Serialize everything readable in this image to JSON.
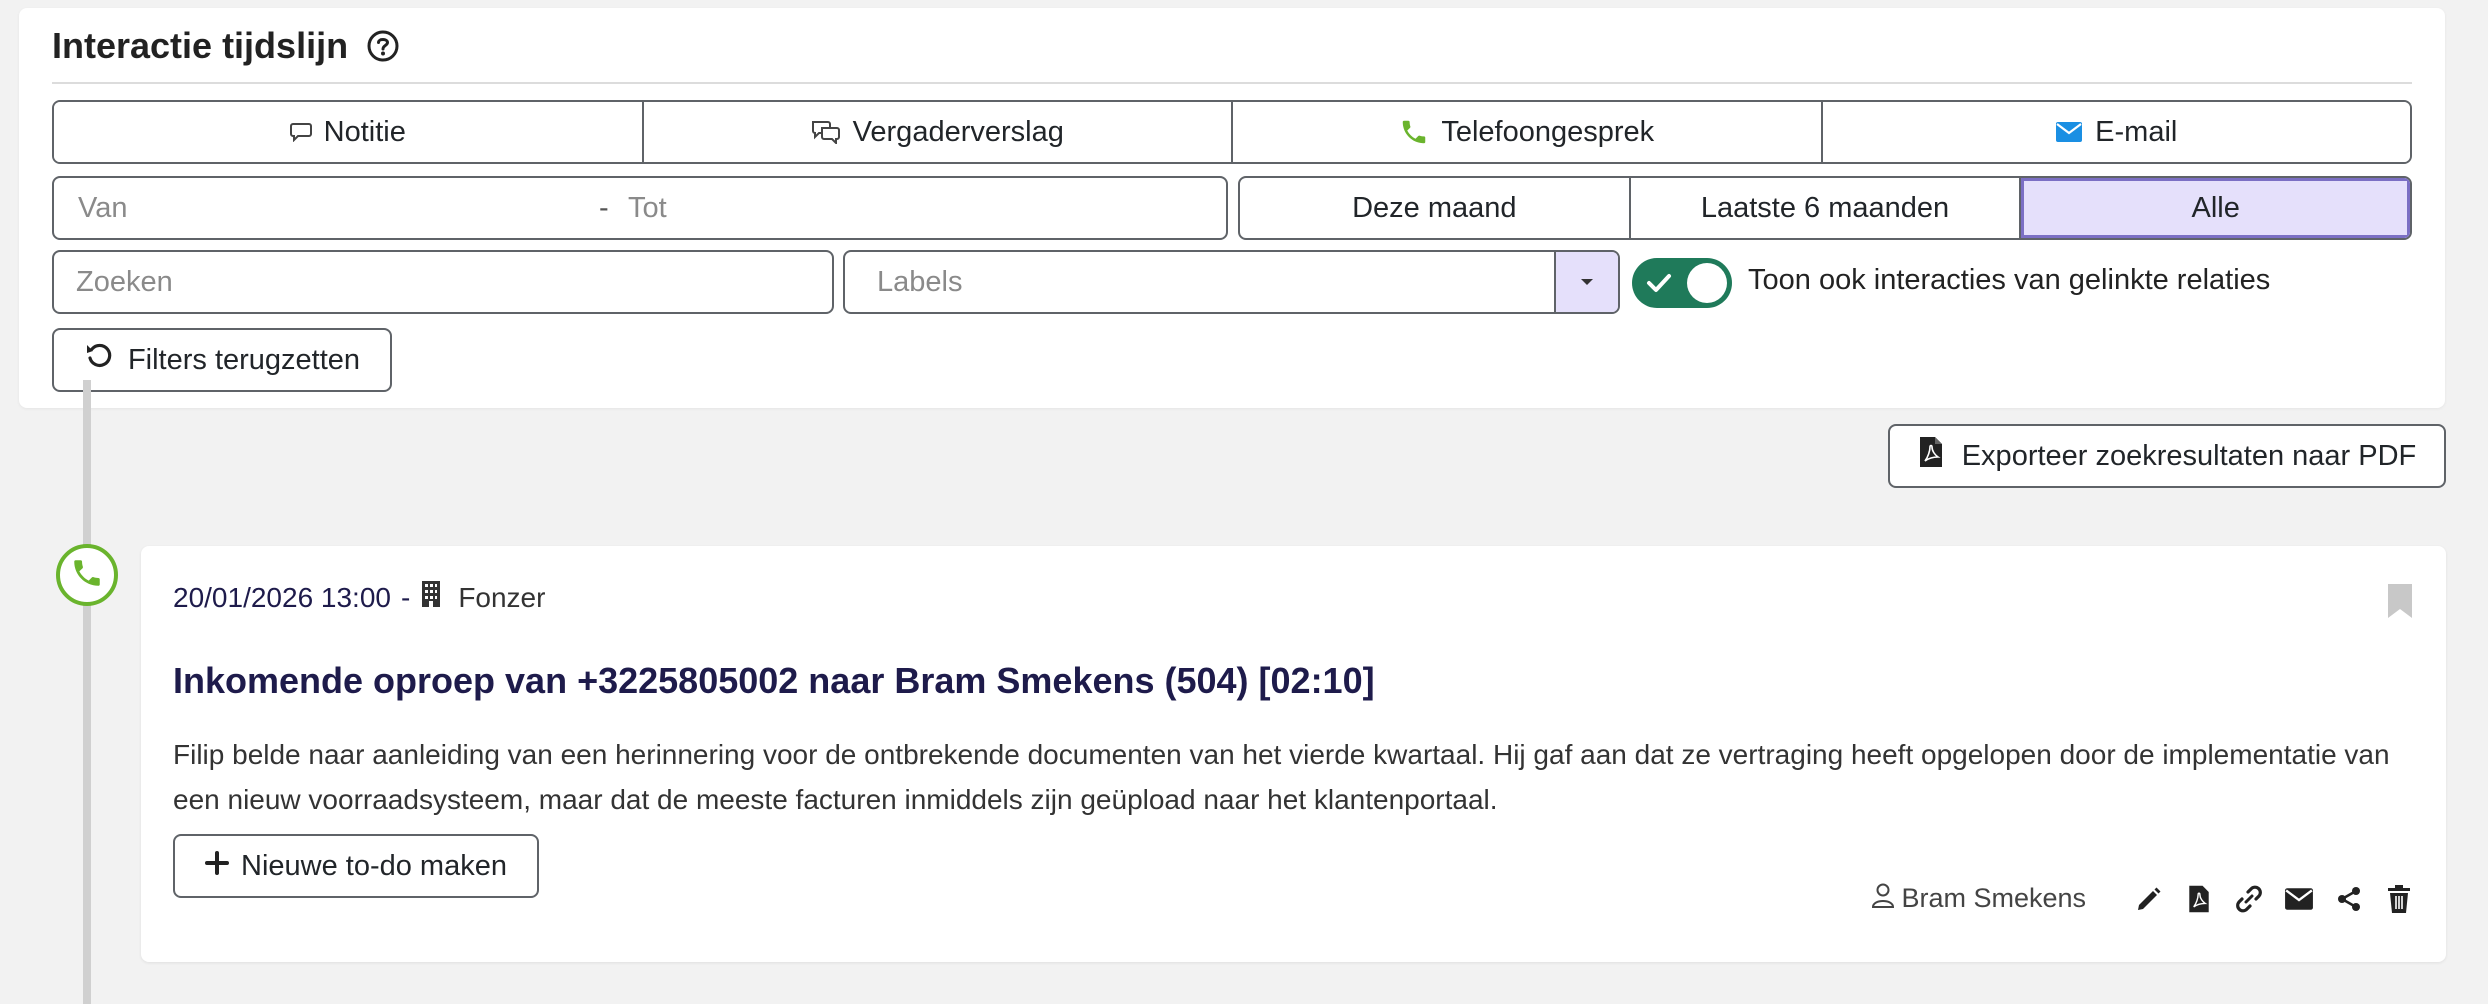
{
  "header": {
    "title": "Interactie tijdslijn"
  },
  "type_filters": [
    {
      "label": "Notitie",
      "icon": "note-icon"
    },
    {
      "label": "Vergaderverslag",
      "icon": "meeting-icon"
    },
    {
      "label": "Telefoongesprek",
      "icon": "phone-icon"
    },
    {
      "label": "E-mail",
      "icon": "envelope-icon"
    }
  ],
  "date_range": {
    "from_placeholder": "Van",
    "separator": "-",
    "to_placeholder": "Tot"
  },
  "period_filters": [
    {
      "label": "Deze maand",
      "active": false
    },
    {
      "label": "Laatste 6 maanden",
      "active": false
    },
    {
      "label": "Alle",
      "active": true
    }
  ],
  "search": {
    "placeholder": "Zoeken"
  },
  "labels": {
    "placeholder": "Labels"
  },
  "linked_toggle": {
    "label": "Toon ook interacties van gelinkte relaties",
    "checked": true
  },
  "reset": {
    "label": "Filters terugzetten"
  },
  "export": {
    "label": "Exporteer zoekresultaten naar PDF"
  },
  "item": {
    "datetime": "20/01/2026 13:00",
    "separator": "-",
    "company": "Fonzer",
    "title": "Inkomende oproep van +3225805002 naar Bram Smekens (504) [02:10]",
    "body": "Filip belde naar aanleiding van een herinnering voor de ontbrekende documenten van het vierde kwartaal. Hij gaf aan dat ze vertraging heeft opgelopen door de implementatie van een nieuw voorraadsysteem, maar dat de meeste facturen inmiddels zijn geüpload naar het klantenportaal.",
    "todo_label": "Nieuwe to-do maken",
    "author": "Bram Smekens"
  },
  "colors": {
    "accent_purple": "#e5e0fb",
    "toggle_green": "#1f7a5a",
    "phone_green": "#6ab42d",
    "email_blue": "#1a8fe3",
    "title_navy": "#1e1b4b"
  }
}
